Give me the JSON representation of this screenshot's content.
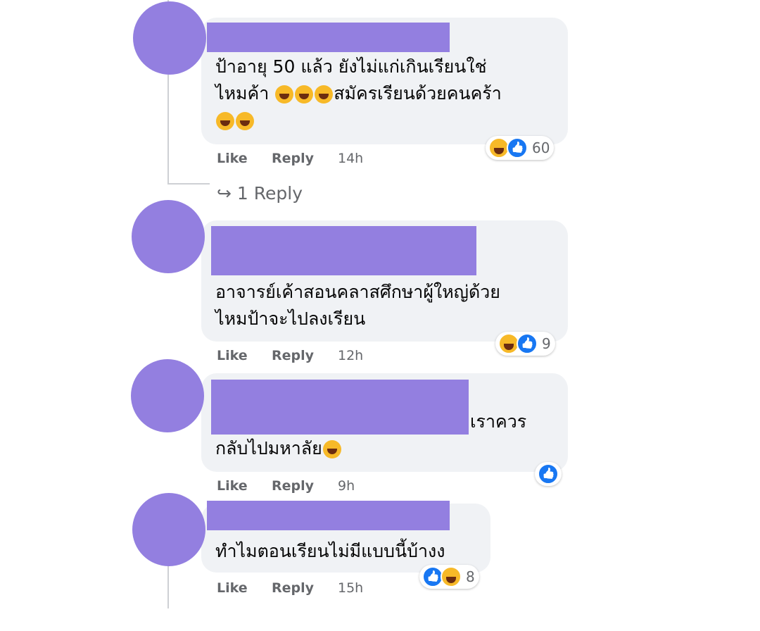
{
  "actions": {
    "like": "Like",
    "reply": "Reply"
  },
  "comments": [
    {
      "lines": [
        "ป้าอายุ 50 แล้ว ยังไม่แก่เกินเรียนใช่",
        "ไหมค้า",
        "สมัครเรียนด้วยคนคร้า"
      ],
      "time": "14h",
      "reaction_icons": [
        "haha-icon",
        "like-icon"
      ],
      "reaction_count": "60",
      "replies_label": "↪ 1 Reply"
    },
    {
      "lines": [
        "อาจารย์เค้าสอนคลาสศึกษาผู้ใหญ่ด้วย",
        "ไหมป้าจะไปลงเรียน"
      ],
      "time": "12h",
      "reaction_icons": [
        "haha-icon",
        "like-icon"
      ],
      "reaction_count": "9"
    },
    {
      "lines": [
        "เราควร",
        "กลับไปมหาลัย"
      ],
      "time": "9h",
      "reaction_icons": [
        "like-icon"
      ]
    },
    {
      "lines": [
        "ทำไมตอนเรียนไม่มีแบบนี้บ้างง"
      ],
      "time": "15h",
      "reaction_icons": [
        "like-icon",
        "haha-icon"
      ],
      "reaction_count": "8"
    }
  ]
}
